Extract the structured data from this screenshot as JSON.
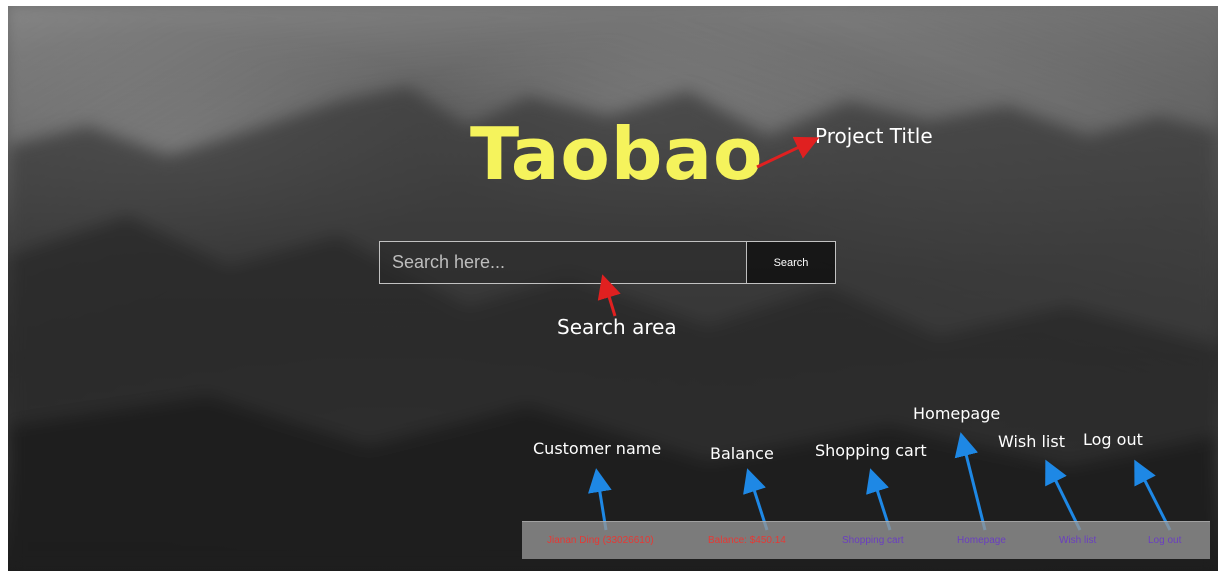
{
  "app": {
    "title": "Taobao"
  },
  "search": {
    "placeholder": "Search here...",
    "value": "",
    "button_label": "Search"
  },
  "footer": {
    "customer_name": "Jianan Ding (33026610)",
    "balance": "Balance: $450.14",
    "shopping_cart": "Shopping cart",
    "homepage": "Homepage",
    "wish_list": "Wish list",
    "log_out": "Log out"
  },
  "annotations": {
    "project_title": "Project Title",
    "search_area": "Search area",
    "customer_name": "Customer name",
    "balance": "Balance",
    "shopping_cart": "Shopping cart",
    "homepage": "Homepage",
    "wish_list": "Wish list",
    "log_out": "Log out"
  },
  "colors": {
    "title": "#f5f35c",
    "red_arrow": "#e02020",
    "blue_arrow": "#1e88e5",
    "footer_red_text": "#e53935",
    "footer_link_text": "#6a3fc0"
  }
}
